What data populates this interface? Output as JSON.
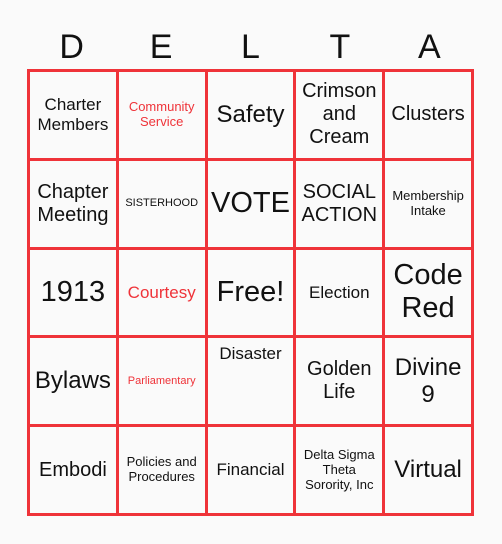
{
  "card": {
    "header_letters": [
      "D",
      "E",
      "L",
      "T",
      "A"
    ],
    "accent_color": "#ef3339",
    "background_color": "#fafafa",
    "cells": [
      [
        {
          "text": "Charter Members",
          "color": "black"
        },
        {
          "text": "Community Service",
          "color": "red"
        },
        {
          "text": "Safety",
          "color": "black"
        },
        {
          "text": "Crimson and Cream",
          "color": "black"
        },
        {
          "text": "Clusters",
          "color": "black"
        }
      ],
      [
        {
          "text": "Chapter Meeting",
          "color": "black"
        },
        {
          "text": "SISTERHOOD",
          "color": "black"
        },
        {
          "text": "VOTE",
          "color": "black"
        },
        {
          "text": "SOCIAL ACTION",
          "color": "black"
        },
        {
          "text": "Membership Intake",
          "color": "black"
        }
      ],
      [
        {
          "text": "1913",
          "color": "black"
        },
        {
          "text": "Courtesy",
          "color": "red"
        },
        {
          "text": "Free!",
          "color": "black"
        },
        {
          "text": "Election",
          "color": "black"
        },
        {
          "text": "Code Red",
          "color": "black"
        }
      ],
      [
        {
          "text": "Bylaws",
          "color": "black"
        },
        {
          "text": "Parliamentary",
          "color": "red"
        },
        {
          "text": "Disaster",
          "color": "black"
        },
        {
          "text": "Golden Life",
          "color": "black"
        },
        {
          "text": "Divine 9",
          "color": "black"
        }
      ],
      [
        {
          "text": "Embodi",
          "color": "black"
        },
        {
          "text": "Policies and Procedures",
          "color": "black"
        },
        {
          "text": "Financial",
          "color": "black"
        },
        {
          "text": "Delta Sigma Theta Sorority, Inc",
          "color": "black"
        },
        {
          "text": "Virtual",
          "color": "black"
        }
      ]
    ]
  }
}
